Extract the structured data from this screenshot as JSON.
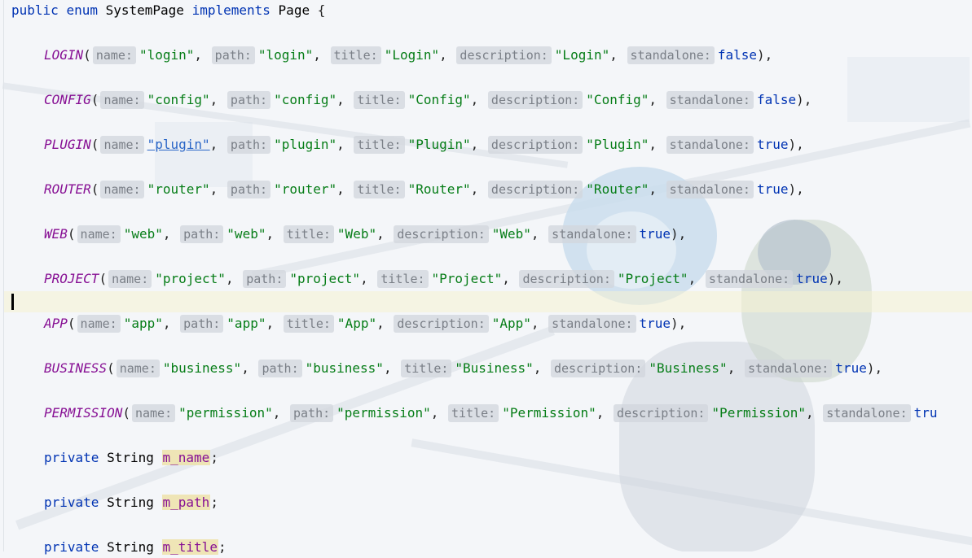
{
  "header": {
    "public_kw": "public",
    "enum_kw": "enum",
    "class_name": "SystemPage",
    "implements_kw": "implements",
    "interface_name": "Page",
    "open_brace": "{"
  },
  "param_labels": {
    "name": "name:",
    "path": "path:",
    "title": "title:",
    "description": "description:",
    "standalone": "standalone:"
  },
  "enum_constants": [
    {
      "const": "LOGIN",
      "name": "\"login\"",
      "path": "\"login\"",
      "title": "\"Login\"",
      "description": "\"Login\"",
      "standalone": "false",
      "end": "),"
    },
    {
      "const": "CONFIG",
      "name": "\"config\"",
      "path": "\"config\"",
      "title": "\"Config\"",
      "description": "\"Config\"",
      "standalone": "false",
      "end": "),"
    },
    {
      "const": "PLUGIN",
      "name": "\"plugin\"",
      "path": "\"plugin\"",
      "title": "\"Plugin\"",
      "description": "\"Plugin\"",
      "standalone": "true",
      "end": "),"
    },
    {
      "const": "ROUTER",
      "name": "\"router\"",
      "path": "\"router\"",
      "title": "\"Router\"",
      "description": "\"Router\"",
      "standalone": "true",
      "end": "),"
    },
    {
      "const": "WEB",
      "name": "\"web\"",
      "path": "\"web\"",
      "title": "\"Web\"",
      "description": "\"Web\"",
      "standalone": "true",
      "end": "),"
    },
    {
      "const": "PROJECT",
      "name": "\"project\"",
      "path": "\"project\"",
      "title": "\"Project\"",
      "description": "\"Project\"",
      "standalone": "true",
      "end": "),"
    },
    {
      "const": "APP",
      "name": "\"app\"",
      "path": "\"app\"",
      "title": "\"App\"",
      "description": "\"App\"",
      "standalone": "true",
      "end": "),"
    },
    {
      "const": "BUSINESS",
      "name": "\"business\"",
      "path": "\"business\"",
      "title": "\"Business\"",
      "description": "\"Business\"",
      "standalone": "true",
      "end": "),"
    },
    {
      "const": "PERMISSION",
      "name": "\"permission\"",
      "path": "\"permission\"",
      "title": "\"Permission\"",
      "description": "\"Permission\"",
      "standalone": "tru",
      "end": ""
    }
  ],
  "fields": [
    {
      "modifier": "private",
      "type": "String",
      "name": "m_name",
      "end": ";"
    },
    {
      "modifier": "private",
      "type": "String",
      "name": "m_path",
      "end": ";"
    },
    {
      "modifier": "private",
      "type": "String",
      "name": "m_title",
      "end": ";"
    }
  ],
  "colors": {
    "keyword": "#0033b3",
    "string": "#067d17",
    "constant": "#871094",
    "hint_bg": "#d2d6dc"
  }
}
